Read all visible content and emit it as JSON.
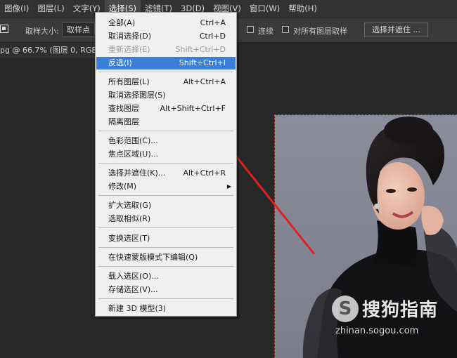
{
  "menubar": {
    "items": [
      "图像(I)",
      "图层(L)",
      "文字(Y)",
      "选择(S)",
      "滤镜(T)",
      "3D(D)",
      "视图(V)",
      "窗口(W)",
      "帮助(H)"
    ],
    "active_index": 3
  },
  "options": {
    "sample_size_label": "取样大小:",
    "sample_size_value": "取样点",
    "contiguous_label": "连续",
    "all_layers_label": "对所有图层取样",
    "select_mask_button": "选择并遮住 ..."
  },
  "document": {
    "tab_title": "pg @ 66.7% (图层 0, RGB/8"
  },
  "select_menu": {
    "items": [
      {
        "label": "全部(A)",
        "shortcut": "Ctrl+A",
        "disabled": false,
        "highlighted": false
      },
      {
        "label": "取消选择(D)",
        "shortcut": "Ctrl+D",
        "disabled": false,
        "highlighted": false
      },
      {
        "label": "重新选择(E)",
        "shortcut": "Shift+Ctrl+D",
        "disabled": true,
        "highlighted": false
      },
      {
        "label": "反选(I)",
        "shortcut": "Shift+Ctrl+I",
        "disabled": false,
        "highlighted": true
      },
      {
        "label": "所有图层(L)",
        "shortcut": "Alt+Ctrl+A",
        "disabled": false,
        "highlighted": false
      },
      {
        "label": "取消选择图层(S)",
        "shortcut": "",
        "disabled": false,
        "highlighted": false
      },
      {
        "label": "查找图层",
        "shortcut": "Alt+Shift+Ctrl+F",
        "disabled": false,
        "highlighted": false
      },
      {
        "label": "隔离图层",
        "shortcut": "",
        "disabled": false,
        "highlighted": false
      },
      {
        "label": "色彩范围(C)...",
        "shortcut": "",
        "disabled": false,
        "highlighted": false
      },
      {
        "label": "焦点区域(U)...",
        "shortcut": "",
        "disabled": false,
        "highlighted": false
      },
      {
        "label": "选择并遮住(K)...",
        "shortcut": "Alt+Ctrl+R",
        "disabled": false,
        "highlighted": false
      },
      {
        "label": "修改(M)",
        "shortcut": "",
        "disabled": false,
        "highlighted": false
      },
      {
        "label": "扩大选取(G)",
        "shortcut": "",
        "disabled": false,
        "highlighted": false
      },
      {
        "label": "选取相似(R)",
        "shortcut": "",
        "disabled": false,
        "highlighted": false
      },
      {
        "label": "变换选区(T)",
        "shortcut": "",
        "disabled": false,
        "highlighted": false
      },
      {
        "label": "在快速蒙版模式下编辑(Q)",
        "shortcut": "",
        "disabled": false,
        "highlighted": false
      },
      {
        "label": "载入选区(O)...",
        "shortcut": "",
        "disabled": false,
        "highlighted": false
      },
      {
        "label": "存储选区(V)...",
        "shortcut": "",
        "disabled": false,
        "highlighted": false
      },
      {
        "label": "新建 3D 模型(3)",
        "shortcut": "",
        "disabled": false,
        "highlighted": false
      }
    ]
  },
  "watermark": {
    "brand": "搜狗指南",
    "url": "zhinan.sogou.com"
  },
  "colors": {
    "highlight": "#3a7ed8",
    "annotation_arrow": "#e02020"
  }
}
